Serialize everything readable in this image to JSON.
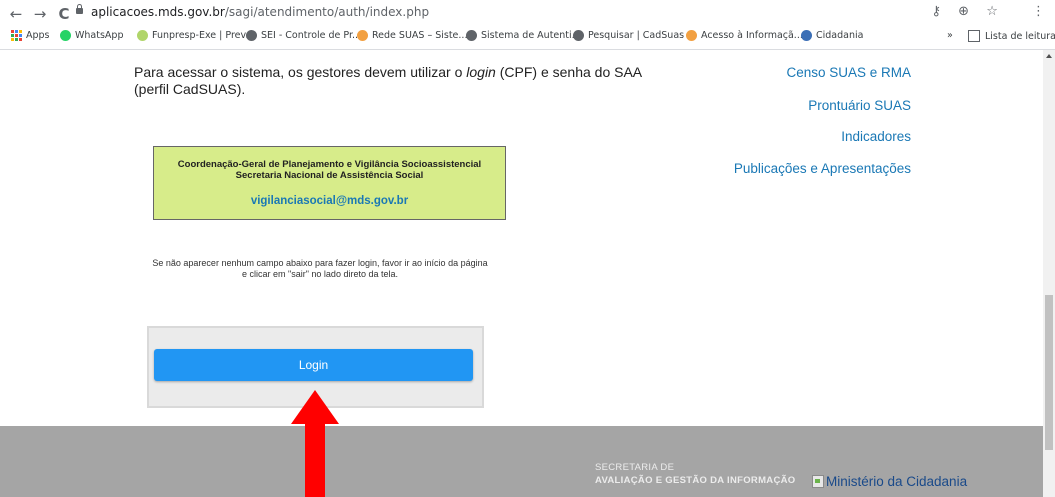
{
  "browser": {
    "nav": {
      "back": "←",
      "forward": "→",
      "reload": "C"
    },
    "url_host": "aplicacoes.mds.gov.br",
    "url_path": "/sagi/atendimento/auth/index.php",
    "icons": {
      "key": "⚷",
      "zoom": "⊕",
      "star": "☆",
      "menu": "⋮"
    },
    "bookmarks": [
      {
        "label": "Apps",
        "icon": "apps-grid",
        "color": "#ea4335"
      },
      {
        "label": "WhatsApp",
        "icon": "whatsapp-icon",
        "color": "#25d366"
      },
      {
        "label": "Funpresp-Exe | Prev...",
        "icon": "funpresp-icon",
        "color": "#b0d56a"
      },
      {
        "label": "SEI - Controle de Pr...",
        "icon": "globe-icon",
        "color": "#5f6368"
      },
      {
        "label": "Rede SUAS – Siste...",
        "icon": "suas-icon",
        "color": "#f2a041"
      },
      {
        "label": "Sistema de Autenti...",
        "icon": "globe-icon",
        "color": "#5f6368"
      },
      {
        "label": "Pesquisar | CadSuas",
        "icon": "globe-icon",
        "color": "#5f6368"
      },
      {
        "label": "Acesso à Informaçã...",
        "icon": "suas-icon",
        "color": "#f2a041"
      },
      {
        "label": "Cidadania",
        "icon": "cidadania-icon",
        "color": "#3b6fb6"
      }
    ],
    "overflow": "»",
    "reading_list": "Lista de leitura"
  },
  "page": {
    "intro_part1": "Para acessar o sistema, os gestores devem utilizar o ",
    "intro_login": "login",
    "intro_part2": " (CPF) e senha do SAA (perfil CadSUAS).",
    "side_links": [
      "Censo SUAS e RMA",
      "Prontuário SUAS",
      "Indicadores",
      "Publicações e Apresentações"
    ],
    "contact": {
      "line1": "Coordenação-Geral de Planejamento e Vigilância Socioassistencial",
      "line2": "Secretaria Nacional de Assistência Social",
      "email": "vigilanciasocial@mds.gov.br"
    },
    "notice_line1": "Se não aparecer nenhum campo abaixo para fazer login, favor ir ao início da página",
    "notice_line2": "e clicar em \"sair\" no lado direto da tela.",
    "login_label": "Login"
  },
  "footer": {
    "secretaria_line1": "SECRETARIA DE",
    "secretaria_line2": "AVALIAÇÃO E GESTÃO DA INFORMAÇÃO",
    "ministerio_alt": "Ministério da Cidadania"
  },
  "colors": {
    "accent": "#2196f3",
    "link": "#1a78b5",
    "contact_bg": "#d7ec8a",
    "arrow": "#ff0000",
    "footer_bg": "#a5a5a5"
  }
}
